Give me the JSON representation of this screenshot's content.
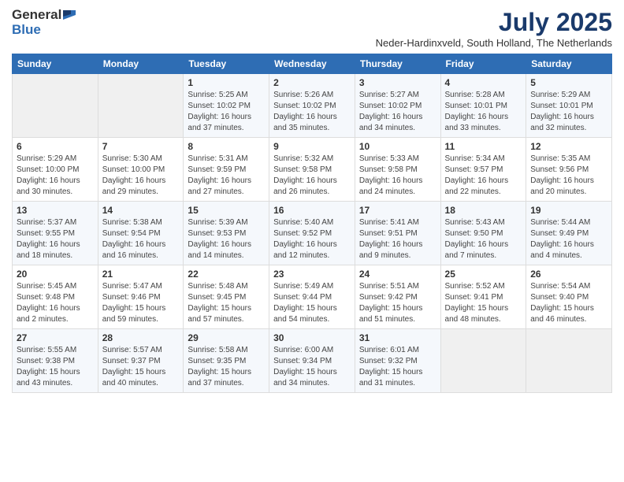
{
  "logo": {
    "general": "General",
    "blue": "Blue"
  },
  "title": "July 2025",
  "location": "Neder-Hardinxveld, South Holland, The Netherlands",
  "headers": [
    "Sunday",
    "Monday",
    "Tuesday",
    "Wednesday",
    "Thursday",
    "Friday",
    "Saturday"
  ],
  "weeks": [
    [
      {
        "day": "",
        "sunrise": "",
        "sunset": "",
        "daylight": ""
      },
      {
        "day": "",
        "sunrise": "",
        "sunset": "",
        "daylight": ""
      },
      {
        "day": "1",
        "sunrise": "Sunrise: 5:25 AM",
        "sunset": "Sunset: 10:02 PM",
        "daylight": "Daylight: 16 hours and 37 minutes."
      },
      {
        "day": "2",
        "sunrise": "Sunrise: 5:26 AM",
        "sunset": "Sunset: 10:02 PM",
        "daylight": "Daylight: 16 hours and 35 minutes."
      },
      {
        "day": "3",
        "sunrise": "Sunrise: 5:27 AM",
        "sunset": "Sunset: 10:02 PM",
        "daylight": "Daylight: 16 hours and 34 minutes."
      },
      {
        "day": "4",
        "sunrise": "Sunrise: 5:28 AM",
        "sunset": "Sunset: 10:01 PM",
        "daylight": "Daylight: 16 hours and 33 minutes."
      },
      {
        "day": "5",
        "sunrise": "Sunrise: 5:29 AM",
        "sunset": "Sunset: 10:01 PM",
        "daylight": "Daylight: 16 hours and 32 minutes."
      }
    ],
    [
      {
        "day": "6",
        "sunrise": "Sunrise: 5:29 AM",
        "sunset": "Sunset: 10:00 PM",
        "daylight": "Daylight: 16 hours and 30 minutes."
      },
      {
        "day": "7",
        "sunrise": "Sunrise: 5:30 AM",
        "sunset": "Sunset: 10:00 PM",
        "daylight": "Daylight: 16 hours and 29 minutes."
      },
      {
        "day": "8",
        "sunrise": "Sunrise: 5:31 AM",
        "sunset": "Sunset: 9:59 PM",
        "daylight": "Daylight: 16 hours and 27 minutes."
      },
      {
        "day": "9",
        "sunrise": "Sunrise: 5:32 AM",
        "sunset": "Sunset: 9:58 PM",
        "daylight": "Daylight: 16 hours and 26 minutes."
      },
      {
        "day": "10",
        "sunrise": "Sunrise: 5:33 AM",
        "sunset": "Sunset: 9:58 PM",
        "daylight": "Daylight: 16 hours and 24 minutes."
      },
      {
        "day": "11",
        "sunrise": "Sunrise: 5:34 AM",
        "sunset": "Sunset: 9:57 PM",
        "daylight": "Daylight: 16 hours and 22 minutes."
      },
      {
        "day": "12",
        "sunrise": "Sunrise: 5:35 AM",
        "sunset": "Sunset: 9:56 PM",
        "daylight": "Daylight: 16 hours and 20 minutes."
      }
    ],
    [
      {
        "day": "13",
        "sunrise": "Sunrise: 5:37 AM",
        "sunset": "Sunset: 9:55 PM",
        "daylight": "Daylight: 16 hours and 18 minutes."
      },
      {
        "day": "14",
        "sunrise": "Sunrise: 5:38 AM",
        "sunset": "Sunset: 9:54 PM",
        "daylight": "Daylight: 16 hours and 16 minutes."
      },
      {
        "day": "15",
        "sunrise": "Sunrise: 5:39 AM",
        "sunset": "Sunset: 9:53 PM",
        "daylight": "Daylight: 16 hours and 14 minutes."
      },
      {
        "day": "16",
        "sunrise": "Sunrise: 5:40 AM",
        "sunset": "Sunset: 9:52 PM",
        "daylight": "Daylight: 16 hours and 12 minutes."
      },
      {
        "day": "17",
        "sunrise": "Sunrise: 5:41 AM",
        "sunset": "Sunset: 9:51 PM",
        "daylight": "Daylight: 16 hours and 9 minutes."
      },
      {
        "day": "18",
        "sunrise": "Sunrise: 5:43 AM",
        "sunset": "Sunset: 9:50 PM",
        "daylight": "Daylight: 16 hours and 7 minutes."
      },
      {
        "day": "19",
        "sunrise": "Sunrise: 5:44 AM",
        "sunset": "Sunset: 9:49 PM",
        "daylight": "Daylight: 16 hours and 4 minutes."
      }
    ],
    [
      {
        "day": "20",
        "sunrise": "Sunrise: 5:45 AM",
        "sunset": "Sunset: 9:48 PM",
        "daylight": "Daylight: 16 hours and 2 minutes."
      },
      {
        "day": "21",
        "sunrise": "Sunrise: 5:47 AM",
        "sunset": "Sunset: 9:46 PM",
        "daylight": "Daylight: 15 hours and 59 minutes."
      },
      {
        "day": "22",
        "sunrise": "Sunrise: 5:48 AM",
        "sunset": "Sunset: 9:45 PM",
        "daylight": "Daylight: 15 hours and 57 minutes."
      },
      {
        "day": "23",
        "sunrise": "Sunrise: 5:49 AM",
        "sunset": "Sunset: 9:44 PM",
        "daylight": "Daylight: 15 hours and 54 minutes."
      },
      {
        "day": "24",
        "sunrise": "Sunrise: 5:51 AM",
        "sunset": "Sunset: 9:42 PM",
        "daylight": "Daylight: 15 hours and 51 minutes."
      },
      {
        "day": "25",
        "sunrise": "Sunrise: 5:52 AM",
        "sunset": "Sunset: 9:41 PM",
        "daylight": "Daylight: 15 hours and 48 minutes."
      },
      {
        "day": "26",
        "sunrise": "Sunrise: 5:54 AM",
        "sunset": "Sunset: 9:40 PM",
        "daylight": "Daylight: 15 hours and 46 minutes."
      }
    ],
    [
      {
        "day": "27",
        "sunrise": "Sunrise: 5:55 AM",
        "sunset": "Sunset: 9:38 PM",
        "daylight": "Daylight: 15 hours and 43 minutes."
      },
      {
        "day": "28",
        "sunrise": "Sunrise: 5:57 AM",
        "sunset": "Sunset: 9:37 PM",
        "daylight": "Daylight: 15 hours and 40 minutes."
      },
      {
        "day": "29",
        "sunrise": "Sunrise: 5:58 AM",
        "sunset": "Sunset: 9:35 PM",
        "daylight": "Daylight: 15 hours and 37 minutes."
      },
      {
        "day": "30",
        "sunrise": "Sunrise: 6:00 AM",
        "sunset": "Sunset: 9:34 PM",
        "daylight": "Daylight: 15 hours and 34 minutes."
      },
      {
        "day": "31",
        "sunrise": "Sunrise: 6:01 AM",
        "sunset": "Sunset: 9:32 PM",
        "daylight": "Daylight: 15 hours and 31 minutes."
      },
      {
        "day": "",
        "sunrise": "",
        "sunset": "",
        "daylight": ""
      },
      {
        "day": "",
        "sunrise": "",
        "sunset": "",
        "daylight": ""
      }
    ]
  ]
}
